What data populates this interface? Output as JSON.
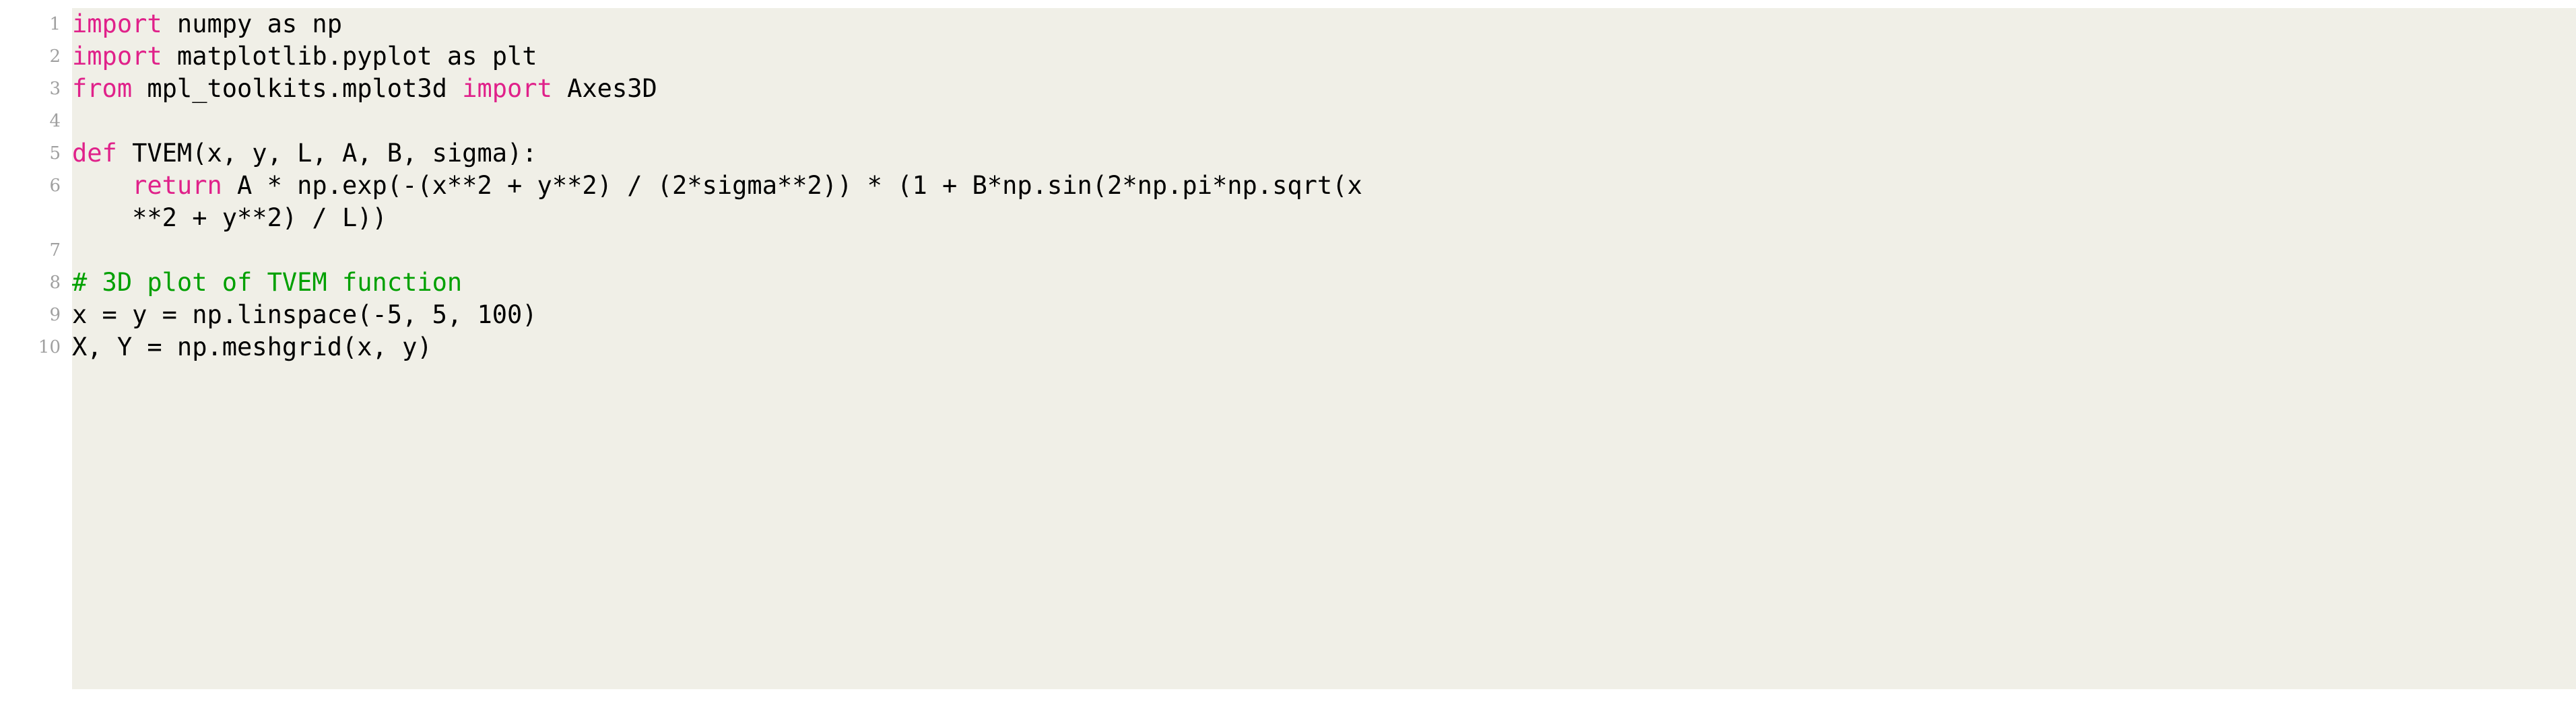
{
  "listing": {
    "language": "python",
    "background_color": "#f0efe7",
    "page_color": "#ffffff",
    "colors": {
      "keyword": "#e0218a",
      "comment": "#00a000",
      "text": "#000000",
      "lineno": "#a0a0a0"
    },
    "lines": [
      {
        "number": "1",
        "continuation": false,
        "tokens": [
          {
            "t": "import",
            "c": "kw"
          },
          {
            "t": " numpy as np",
            "c": "plain"
          }
        ]
      },
      {
        "number": "2",
        "continuation": false,
        "tokens": [
          {
            "t": "import",
            "c": "kw"
          },
          {
            "t": " matplotlib.pyplot as plt",
            "c": "plain"
          }
        ]
      },
      {
        "number": "3",
        "continuation": false,
        "tokens": [
          {
            "t": "from",
            "c": "kw"
          },
          {
            "t": " mpl_toolkits.mplot3d ",
            "c": "plain"
          },
          {
            "t": "import",
            "c": "kw"
          },
          {
            "t": " Axes3D",
            "c": "plain"
          }
        ]
      },
      {
        "number": "4",
        "continuation": false,
        "tokens": [
          {
            "t": "",
            "c": "plain"
          }
        ]
      },
      {
        "number": "5",
        "continuation": false,
        "tokens": [
          {
            "t": "def",
            "c": "kw"
          },
          {
            "t": " TVEM(x, y, L, A, B, sigma):",
            "c": "plain"
          }
        ]
      },
      {
        "number": "6",
        "continuation": false,
        "tokens": [
          {
            "t": "    ",
            "c": "plain"
          },
          {
            "t": "return",
            "c": "kw"
          },
          {
            "t": " A * np.exp(-(x**2 + y**2) / (2*sigma**2)) * (1 + B*np.sin(2*np.pi*np.sqrt(x",
            "c": "plain"
          }
        ]
      },
      {
        "number": "",
        "continuation": true,
        "tokens": [
          {
            "t": "    **2 + y**2) / L))",
            "c": "plain"
          }
        ]
      },
      {
        "number": "7",
        "continuation": false,
        "tokens": [
          {
            "t": "",
            "c": "plain"
          }
        ]
      },
      {
        "number": "8",
        "continuation": false,
        "tokens": [
          {
            "t": "# 3D plot of TVEM function",
            "c": "cmt"
          }
        ]
      },
      {
        "number": "9",
        "continuation": false,
        "tokens": [
          {
            "t": "x = y = np.linspace(-5, 5, 100)",
            "c": "plain"
          }
        ]
      },
      {
        "number": "10",
        "continuation": false,
        "tokens": [
          {
            "t": "X, Y = np.meshgrid(x, y)",
            "c": "plain"
          }
        ]
      }
    ]
  }
}
